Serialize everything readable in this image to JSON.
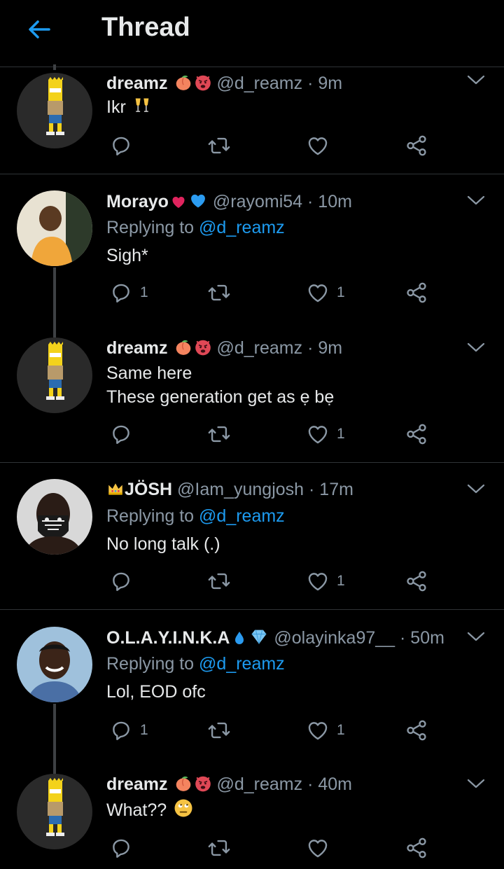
{
  "header": {
    "title": "Thread"
  },
  "tweets": [
    {
      "name": "dreamz",
      "handle": "@d_reamz",
      "time": "· 9m",
      "text1": "Ikr",
      "text2": "",
      "reply_label": "",
      "reply_to": "",
      "replies": "",
      "retweets": "",
      "likes": ""
    },
    {
      "name": "Morayo",
      "handle": "@rayomi54",
      "time": "· 10m",
      "text1": "Sigh*",
      "text2": "",
      "reply_label": "Replying to",
      "reply_to": "@d_reamz",
      "replies": "1",
      "retweets": "",
      "likes": "1"
    },
    {
      "name": "dreamz",
      "handle": "@d_reamz",
      "time": "· 9m",
      "text1": "Same here",
      "text2": "These generation get as ẹ bẹ",
      "reply_label": "",
      "reply_to": "",
      "replies": "",
      "retweets": "",
      "likes": "1"
    },
    {
      "name": "JÖSH",
      "handle": "@Iam_yungjosh",
      "time": "· 17m",
      "text1": "No long talk (.)",
      "text2": "",
      "reply_label": "Replying to",
      "reply_to": "@d_reamz",
      "replies": "",
      "retweets": "",
      "likes": "1"
    },
    {
      "name": "O.L.A.Y.I.N.K.A",
      "handle": "@olayinka97__",
      "time": "· 50m",
      "text1": "Lol, EOD ofc",
      "text2": "",
      "reply_label": "Replying to",
      "reply_to": "@d_reamz",
      "replies": "1",
      "retweets": "",
      "likes": "1"
    },
    {
      "name": "dreamz",
      "handle": "@d_reamz",
      "time": "· 40m",
      "text1": "What??",
      "text2": "",
      "reply_label": "",
      "reply_to": "",
      "replies": "",
      "retweets": "",
      "likes": ""
    }
  ],
  "colors": {
    "accent": "#1d9bf0",
    "secondary_text": "#8b98a5",
    "separator": "#2f3336"
  },
  "icons": {
    "back": "arrow-left-icon",
    "caret": "chevron-down-icon",
    "reply": "comment-icon",
    "retweet": "retweet-icon",
    "like": "heart-icon",
    "share": "share-icon"
  }
}
